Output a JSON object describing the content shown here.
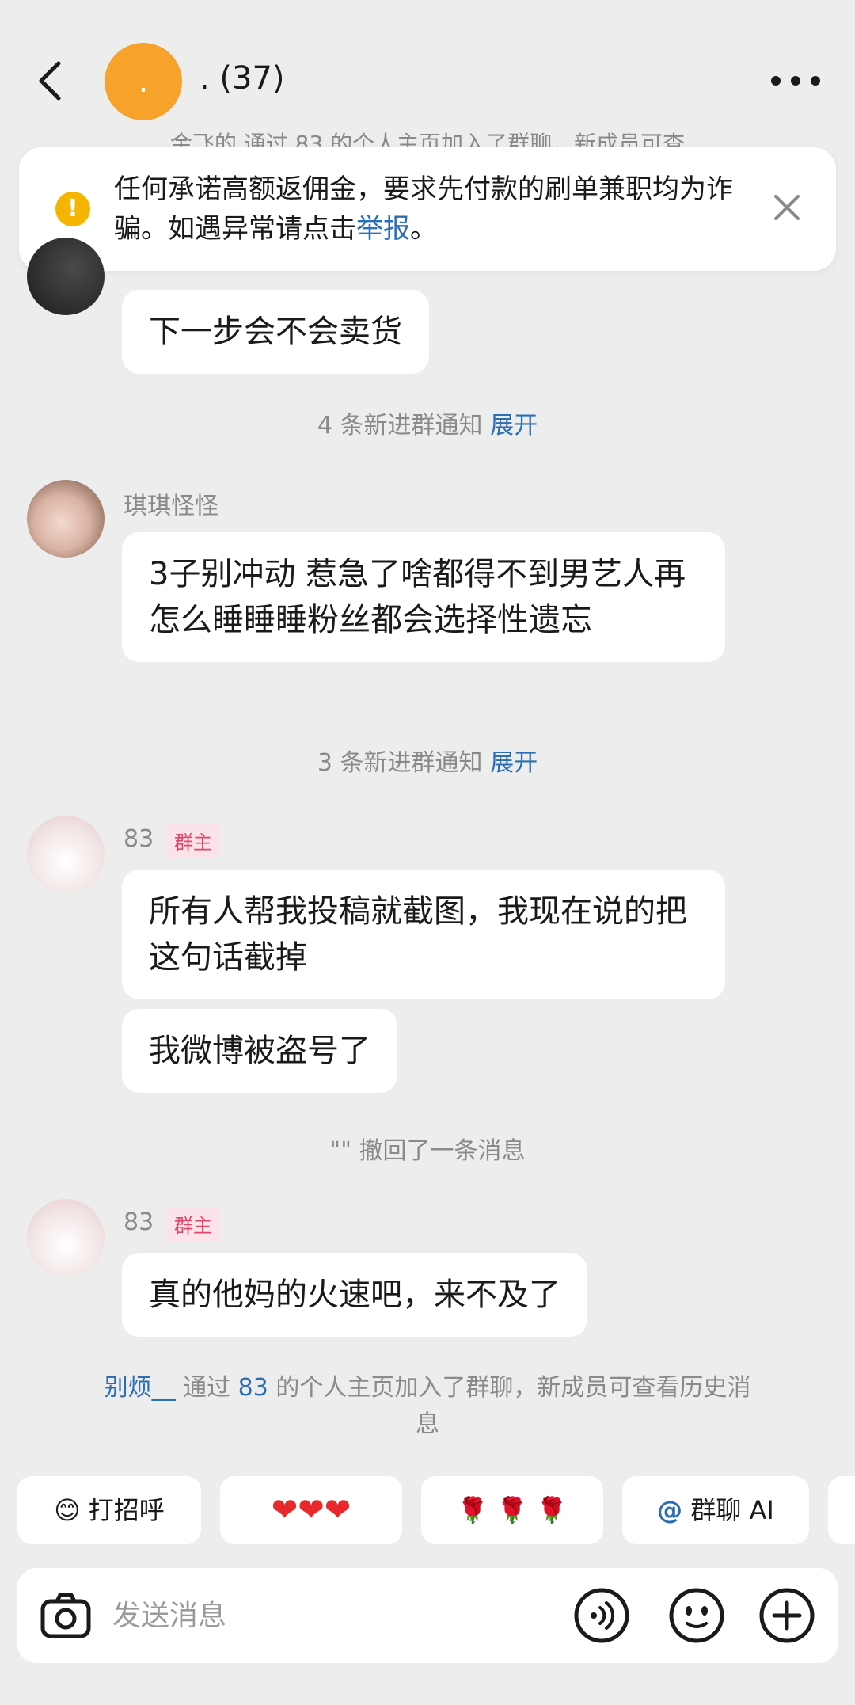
{
  "header": {
    "group_avatar_text": ".",
    "title": ". (37)",
    "top_system_line": "金飞的 通过 83 的个人主页加入了群聊，新成员可查"
  },
  "warning": {
    "text_main": "任何承诺高额返佣金，要求先付款的刷单兼职均为诈骗。如遇异常请点击",
    "report_link": "举报",
    "text_end": "。",
    "icon": "!"
  },
  "messages": {
    "m1": {
      "text": "下一步会不会卖货"
    },
    "notice1": {
      "text": "4 条新进群通知 ",
      "link": "展开"
    },
    "m2": {
      "sender": "琪琪怪怪",
      "text": "3子别冲动 惹急了啥都得不到男艺人再怎么睡睡睡粉丝都会选择性遗忘"
    },
    "notice2": {
      "text": "3 条新进群通知 ",
      "link": "展开"
    },
    "m3": {
      "sender": "83",
      "badge": "群主",
      "text1": "所有人帮我投稿就截图，我现在说的把这句话截掉",
      "text2": "我微博被盗号了"
    },
    "recall": {
      "text": "\"\" 撤回了一条消息"
    },
    "m4": {
      "sender": "83",
      "badge": "群主",
      "text": "真的他妈的火速吧，来不及了"
    },
    "join_notice": {
      "user": "别烦__",
      "mid1": " 通过 ",
      "owner": "83",
      "mid2": " 的个人主页加入了群聊，新成员可查看历史消息"
    }
  },
  "quick_replies": {
    "greet": "打招呼",
    "hearts": "❤❤❤",
    "roses": "🌹 🌹 🌹",
    "ai_at": "@",
    "ai_label": "群聊 AI"
  },
  "input": {
    "placeholder": "发送消息"
  },
  "colors": {
    "link": "#2a6fb5",
    "owner_badge": "#e0456a",
    "warning": "#f5b400",
    "group_avatar": "#f7a32b"
  }
}
